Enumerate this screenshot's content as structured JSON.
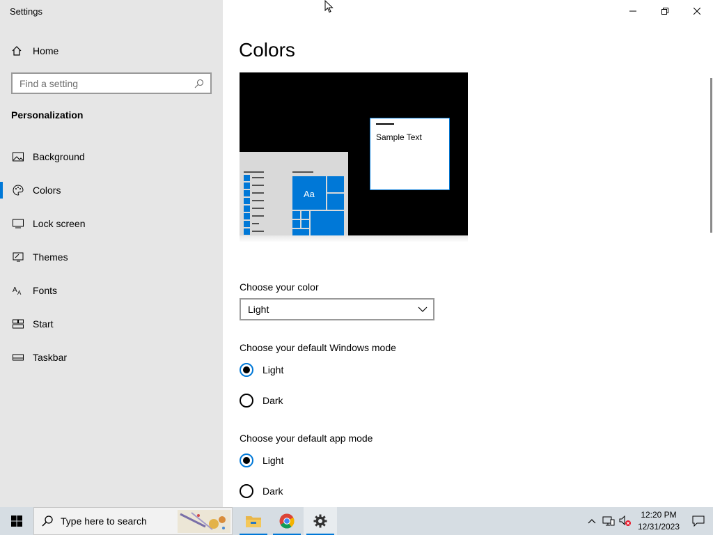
{
  "app": {
    "title": "Settings"
  },
  "sidebar": {
    "home_label": "Home",
    "search_placeholder": "Find a setting",
    "section_title": "Personalization",
    "items": [
      {
        "label": "Background",
        "icon": "picture-icon"
      },
      {
        "label": "Colors",
        "icon": "palette-icon",
        "selected": true
      },
      {
        "label": "Lock screen",
        "icon": "lock-screen-icon"
      },
      {
        "label": "Themes",
        "icon": "themes-icon"
      },
      {
        "label": "Fonts",
        "icon": "fonts-icon"
      },
      {
        "label": "Start",
        "icon": "start-icon"
      },
      {
        "label": "Taskbar",
        "icon": "taskbar-icon"
      }
    ]
  },
  "main": {
    "title": "Colors",
    "preview": {
      "sample_text": "Sample Text",
      "tile_text": "Aa"
    },
    "choose_color": {
      "label": "Choose your color",
      "value": "Light"
    },
    "windows_mode": {
      "label": "Choose your default Windows mode",
      "options": [
        "Light",
        "Dark"
      ],
      "selected": "Light"
    },
    "app_mode": {
      "label": "Choose your default app mode",
      "options": [
        "Light",
        "Dark"
      ],
      "selected": "Light"
    }
  },
  "taskbar": {
    "search_placeholder": "Type here to search",
    "apps": [
      "file-explorer-icon",
      "chrome-icon",
      "settings-gear-icon"
    ],
    "clock": {
      "time": "12:20 PM",
      "date": "12/31/2023"
    }
  },
  "colors": {
    "accent": "#0078d7",
    "sidebar_bg": "#e6e6e6"
  }
}
